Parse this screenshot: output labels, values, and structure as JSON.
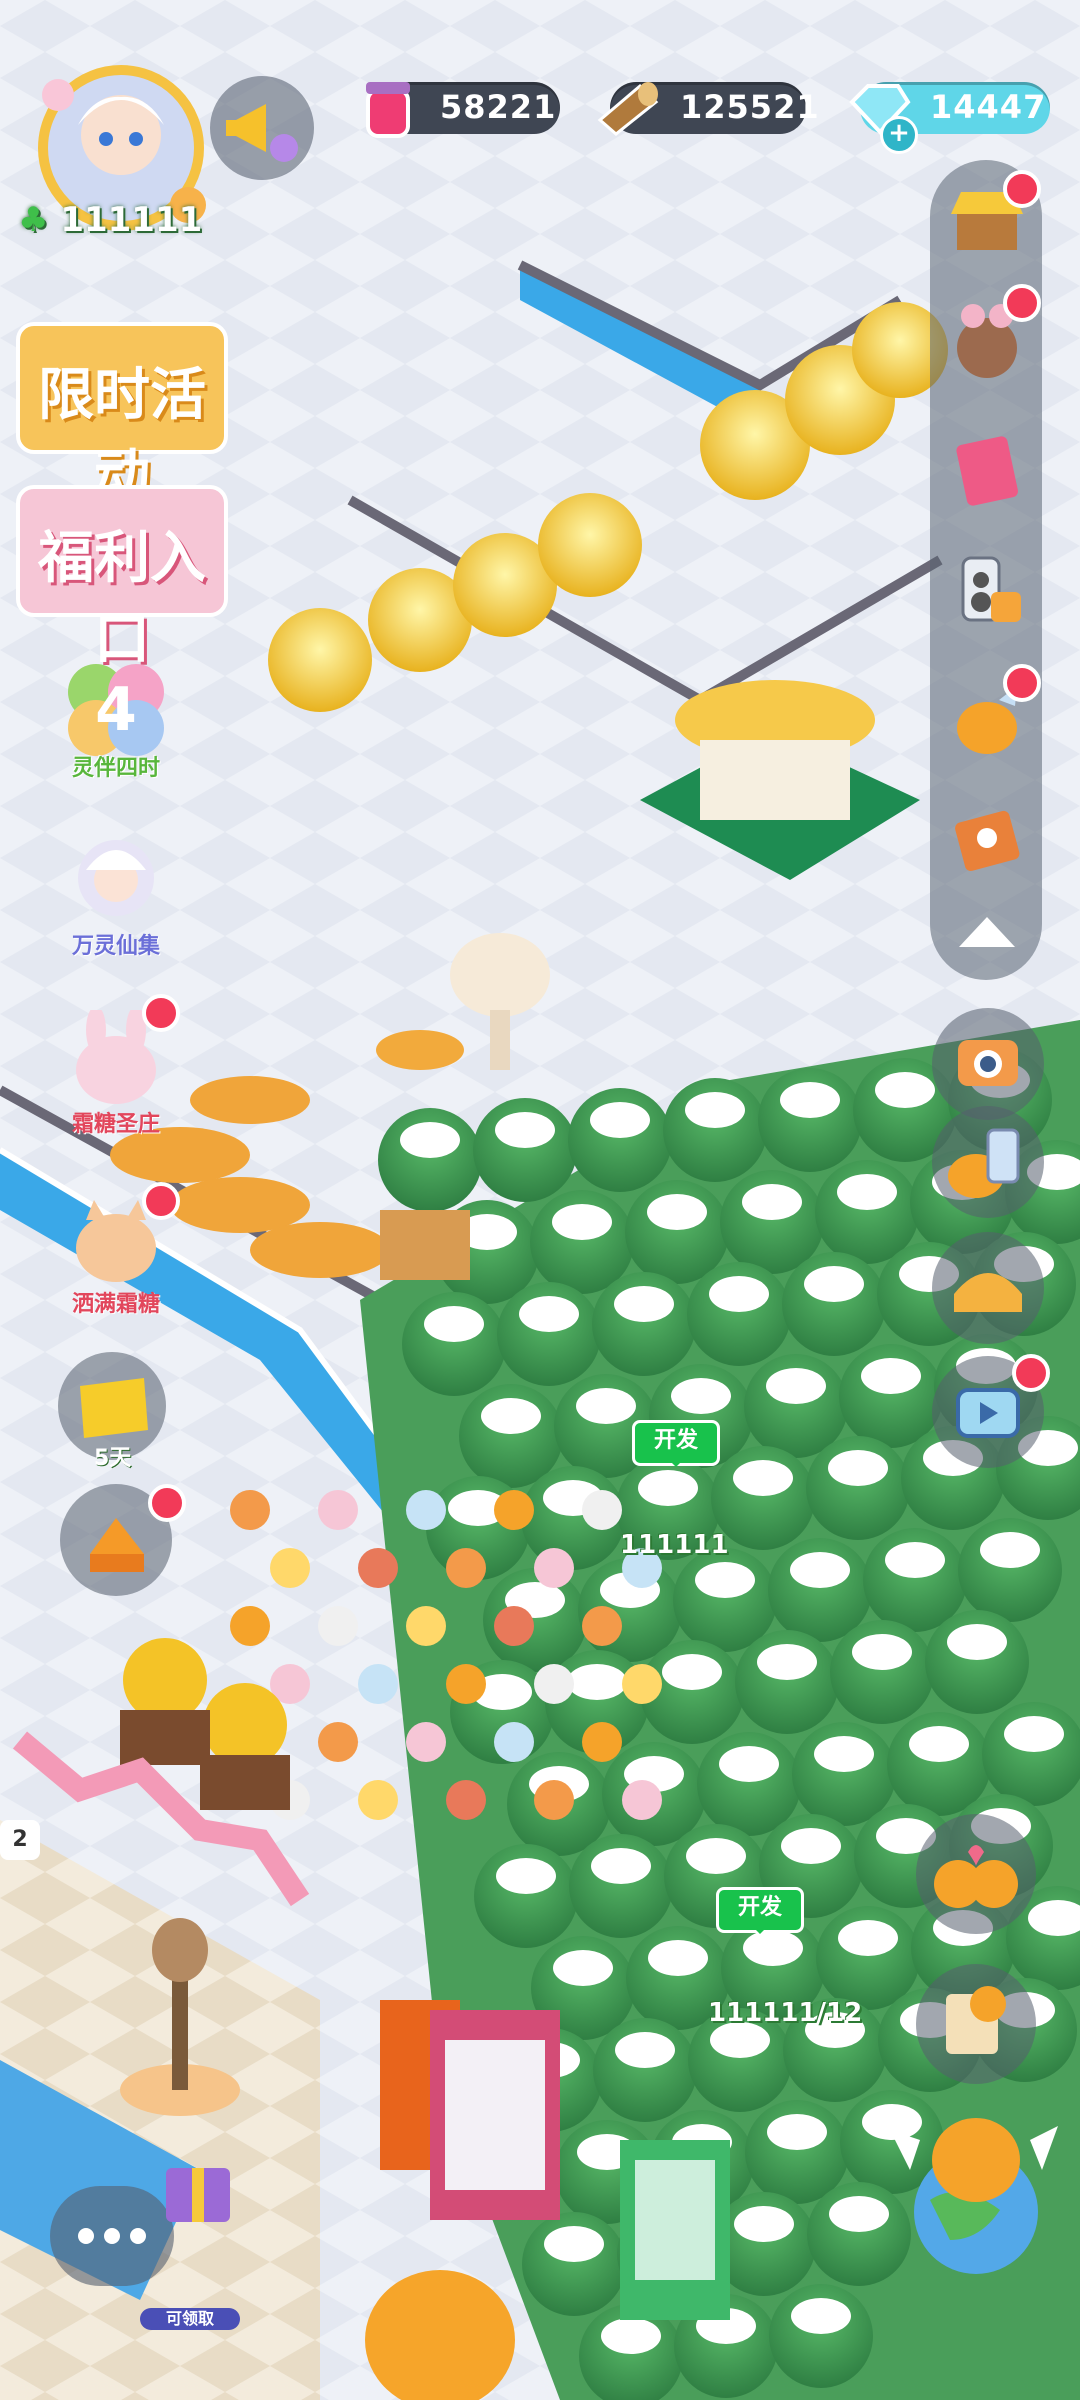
{
  "hud": {
    "potion": {
      "value": "58221",
      "icon": "potion-jar-icon"
    },
    "wood": {
      "value": "125521",
      "icon": "wood-log-icon"
    },
    "gems": {
      "value": "14447",
      "icon": "diamond-icon"
    },
    "clover_count": "111111"
  },
  "left_menu": {
    "limited_event": "限时活动",
    "welfare": "福利入口",
    "items": [
      {
        "label": "灵伴四时",
        "number": "4"
      },
      {
        "label": "万灵仙集"
      },
      {
        "label": "霜糖圣庄"
      },
      {
        "label": "洒满霜糖"
      },
      {
        "label": "5天"
      }
    ]
  },
  "plots": [
    {
      "flag": "开发",
      "number": "111111"
    },
    {
      "flag": "开发",
      "number": "111111/12"
    }
  ],
  "bottom": {
    "claimable": "可领取",
    "left_counter": "2"
  },
  "colors": {
    "snow": "#eef2f8",
    "water": "#3aa8e8",
    "tree": "#3e9a52",
    "accent_red": "#f23a58",
    "flag_green": "#18c24c"
  }
}
